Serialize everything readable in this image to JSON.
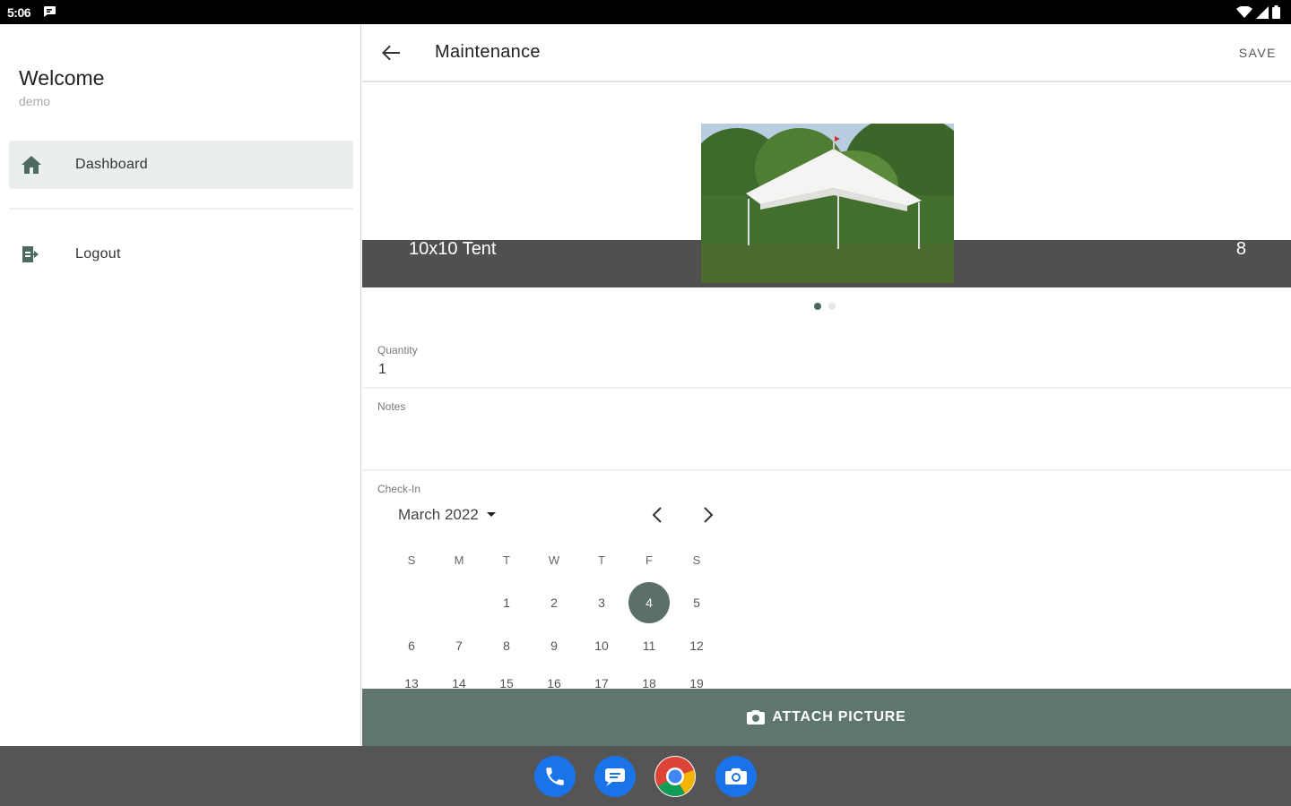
{
  "status_bar": {
    "time": "5:06"
  },
  "drawer": {
    "welcome": "Welcome",
    "username": "demo",
    "items": [
      {
        "label": "Dashboard",
        "icon": "home-icon",
        "active": true
      },
      {
        "label": "Logout",
        "icon": "logout-icon",
        "active": false
      }
    ]
  },
  "appbar": {
    "title": "Maintenance",
    "action": "SAVE"
  },
  "item": {
    "name": "10x10 Tent",
    "count": "8",
    "carousel_pages": 2,
    "carousel_active": 0
  },
  "quantity": {
    "label": "Quantity",
    "value": "1"
  },
  "notes": {
    "label": "Notes",
    "value": ""
  },
  "checkin": {
    "label": "Check-In",
    "month": "March 2022",
    "weekdays": [
      "S",
      "M",
      "T",
      "W",
      "T",
      "F",
      "S"
    ],
    "weeks": [
      [
        "",
        "",
        "1",
        "2",
        "3",
        "4",
        "5"
      ],
      [
        "6",
        "7",
        "8",
        "9",
        "10",
        "11",
        "12"
      ],
      [
        "13",
        "14",
        "15",
        "16",
        "17",
        "18",
        "19"
      ]
    ],
    "selected": "4"
  },
  "attach_label": "ATTACH PICTURE",
  "dock": [
    "phone-icon",
    "messages-icon",
    "chrome-icon",
    "camera-icon"
  ],
  "colors": {
    "accent": "#5f7670",
    "selected_day": "#5a7068",
    "band": "#505050"
  }
}
